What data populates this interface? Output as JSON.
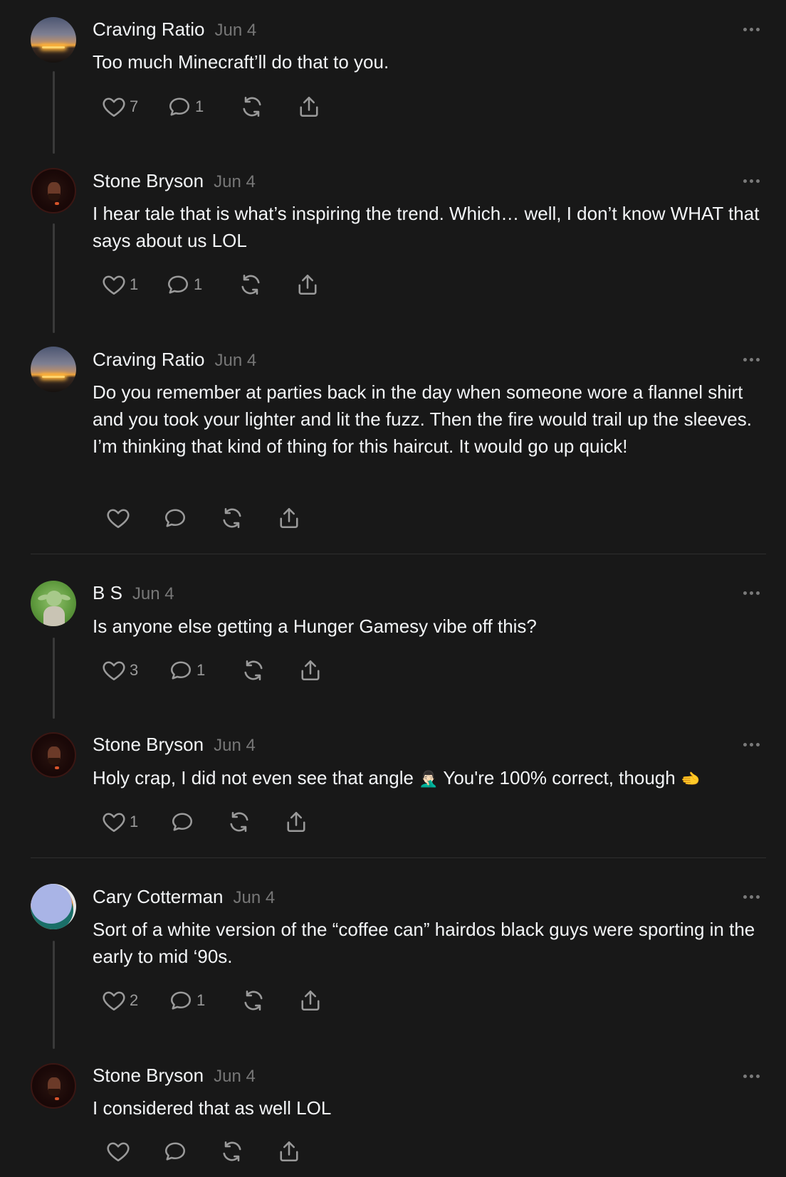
{
  "posts": [
    {
      "name": "Craving Ratio",
      "date": "Jun 4",
      "text": "Too much Minecraft’ll do that to you.",
      "likes": "7",
      "replies": "1"
    },
    {
      "name": "Stone Bryson",
      "date": "Jun 4",
      "text": "I hear tale that is what’s inspiring the trend. Which… well, I don’t know WHAT that says about us LOL",
      "likes": "1",
      "replies": "1"
    },
    {
      "name": "Craving Ratio",
      "date": "Jun 4",
      "text": "Do you remember at parties back in the day when someone wore a flannel shirt and you took your lighter and lit the fuzz. Then the fire would trail up the sleeves. I’m thinking that kind of thing for this haircut. It would go up quick!",
      "likes": "",
      "replies": ""
    },
    {
      "name": "B S",
      "date": "Jun 4",
      "text": "Is anyone else getting a Hunger Gamesy vibe off this?",
      "likes": "3",
      "replies": "1"
    },
    {
      "name": "Stone Bryson",
      "date": "Jun 4",
      "text_a": "Holy crap, I did not even see that angle",
      "emoji_a": "🤦🏻‍♂️",
      "text_b": "You're 100% correct, though",
      "emoji_b": "🫲",
      "likes": "1",
      "replies": ""
    },
    {
      "name": "Cary Cotterman",
      "date": "Jun 4",
      "text": "Sort of a white version of the “coffee can” hairdos black guys were sporting in the early to mid ‘90s.",
      "likes": "2",
      "replies": "1"
    },
    {
      "name": "Stone Bryson",
      "date": "Jun 4",
      "text": "I considered that as well LOL",
      "likes": "",
      "replies": ""
    }
  ],
  "icons": {
    "like": "heart-icon",
    "reply": "comment-icon",
    "repost": "repost-icon",
    "share": "share-icon",
    "more": "more-icon"
  },
  "colors": {
    "background": "#181818",
    "text": "#f3f5f7",
    "muted": "#777777",
    "line": "#3a3a3a"
  }
}
